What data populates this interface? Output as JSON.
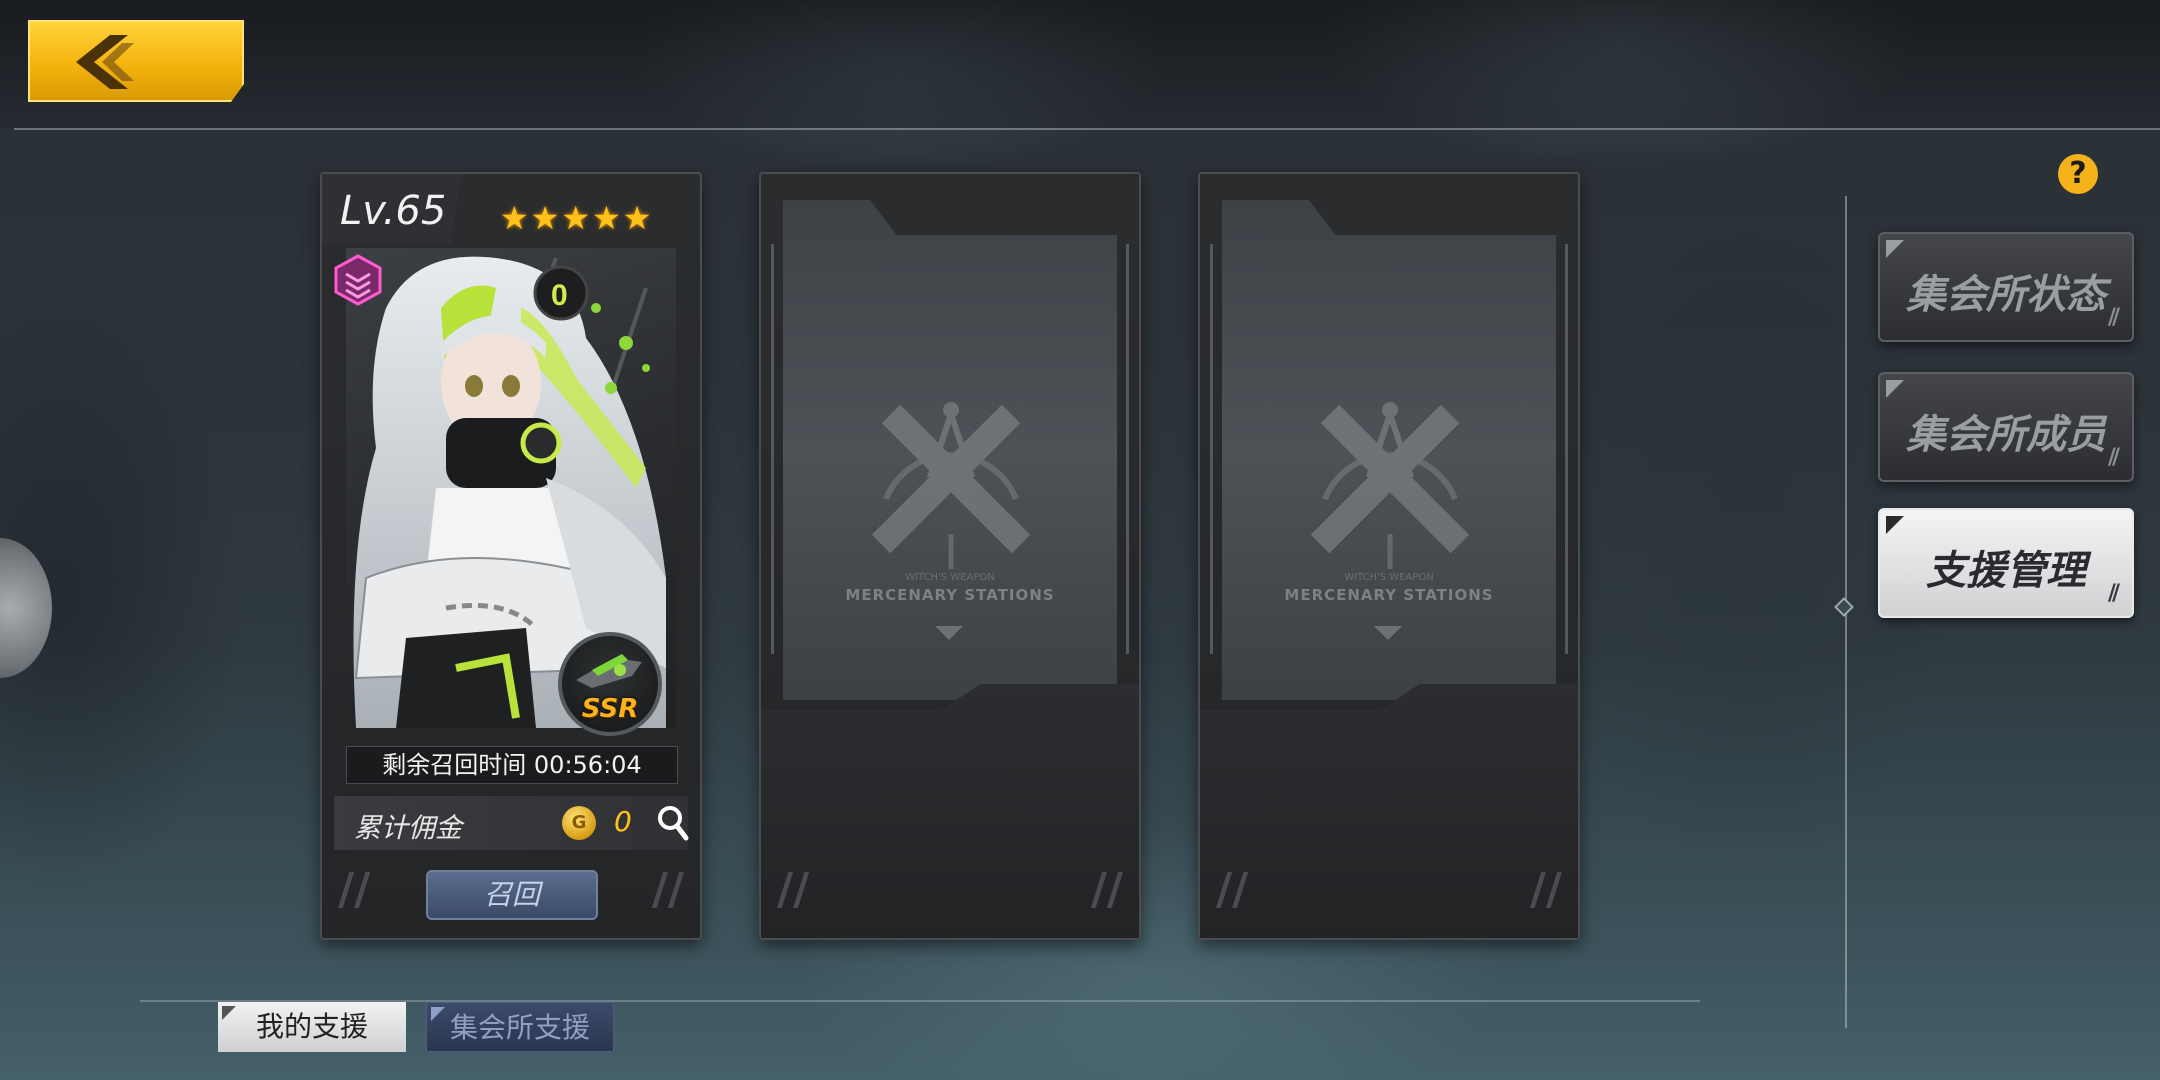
{
  "header": {
    "back_icon": "chevron-left-icon"
  },
  "cards": [
    {
      "type": "character",
      "level": "Lv.65",
      "stars": 5,
      "rarity": "SSR",
      "recall_timer": "剩余召回时间 00:56:04",
      "commission_label": "累计佣金",
      "commission_value": "0",
      "coin_glyph": "G",
      "recall_button": "召回"
    },
    {
      "type": "empty",
      "sub_label": "WITCH'S WEAPON",
      "label": "MERCENARY STATIONS"
    },
    {
      "type": "empty",
      "sub_label": "WITCH'S WEAPON",
      "label": "MERCENARY STATIONS"
    }
  ],
  "side_menu": {
    "help": "?",
    "items": [
      {
        "label": "集会所状态",
        "active": false
      },
      {
        "label": "集会所成员",
        "active": false
      },
      {
        "label": "支援管理",
        "active": true
      }
    ],
    "stripes": "//"
  },
  "bottom_tabs": [
    {
      "label": "我的支援",
      "active": true
    },
    {
      "label": "集会所支援",
      "active": false
    }
  ],
  "colors": {
    "accent": "#f5b30d",
    "star": "#ffc21a",
    "active_tab": "#f2f2f2",
    "recall_button": "#4a5a7a"
  }
}
